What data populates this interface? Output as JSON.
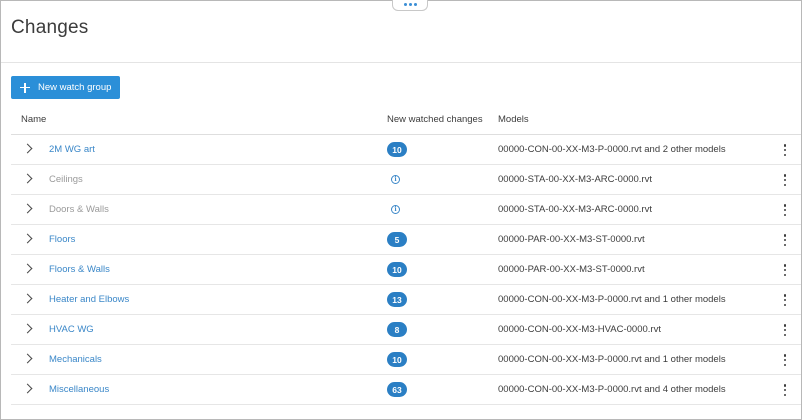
{
  "page": {
    "title": "Changes",
    "new_button_label": "New watch group"
  },
  "table": {
    "columns": {
      "name": "Name",
      "changes": "New watched changes",
      "models": "Models"
    },
    "rows": [
      {
        "name": "2M WG art",
        "changes": "10",
        "muted": false,
        "models": "00000-CON-00-XX-M3-P-0000.rvt and 2 other models"
      },
      {
        "name": "Ceilings",
        "changes": null,
        "muted": true,
        "models": "00000-STA-00-XX-M3-ARC-0000.rvt"
      },
      {
        "name": "Doors & Walls",
        "changes": null,
        "muted": true,
        "models": "00000-STA-00-XX-M3-ARC-0000.rvt"
      },
      {
        "name": "Floors",
        "changes": "5",
        "muted": false,
        "models": "00000-PAR-00-XX-M3-ST-0000.rvt"
      },
      {
        "name": "Floors & Walls",
        "changes": "10",
        "muted": false,
        "models": "00000-PAR-00-XX-M3-ST-0000.rvt"
      },
      {
        "name": "Heater and Elbows",
        "changes": "13",
        "muted": false,
        "models": "00000-CON-00-XX-M3-P-0000.rvt and 1 other models"
      },
      {
        "name": "HVAC WG",
        "changes": "8",
        "muted": false,
        "models": "00000-CON-00-XX-M3-HVAC-0000.rvt"
      },
      {
        "name": "Mechanicals",
        "changes": "10",
        "muted": false,
        "models": "00000-CON-00-XX-M3-P-0000.rvt and 1 other models"
      },
      {
        "name": "Miscellaneous",
        "changes": "63",
        "muted": false,
        "models": "00000-CON-00-XX-M3-P-0000.rvt and 4 other models"
      }
    ]
  },
  "colors": {
    "accent": "#2b8fd8",
    "link": "#3a87c8",
    "badge": "#2b7fc4",
    "muted_text": "#9a9a9a"
  },
  "icons": {
    "expand": "chevron-right-icon",
    "info": "info-icon",
    "more": "more-vertical-icon",
    "add": "plus-icon",
    "panel_handle": "more-horizontal-icon"
  }
}
